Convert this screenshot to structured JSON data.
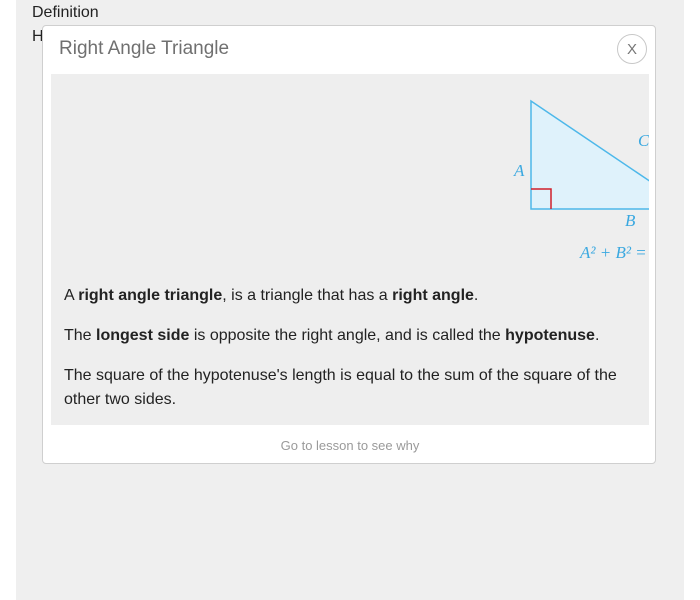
{
  "background": {
    "definition_label": "Definition",
    "partial_letter": "H"
  },
  "modal": {
    "title": "Right Angle Triangle",
    "close_label": "X",
    "diagram": {
      "side_a": "A",
      "side_b": "B",
      "side_c": "C",
      "formula_visible": "A² + B² ="
    },
    "paragraphs": [
      {
        "pre": "A ",
        "b1": "right angle triangle",
        "mid": ", is a triangle that has a ",
        "b2": "right angle",
        "post": "."
      },
      {
        "pre": "The ",
        "b1": "longest side",
        "mid": " is opposite the right angle, and is called the ",
        "b2": "hypotenuse",
        "post": "."
      },
      {
        "text": "The square of the hypotenuse's length is equal to the sum of the square of the other two sides."
      }
    ],
    "footer_link": "Go to lesson to see why"
  },
  "colors": {
    "triangle_stroke": "#4db8ea",
    "triangle_fill": "#dff2fb",
    "right_angle_marker": "#d0202a",
    "label_color": "#3aa8e0"
  }
}
